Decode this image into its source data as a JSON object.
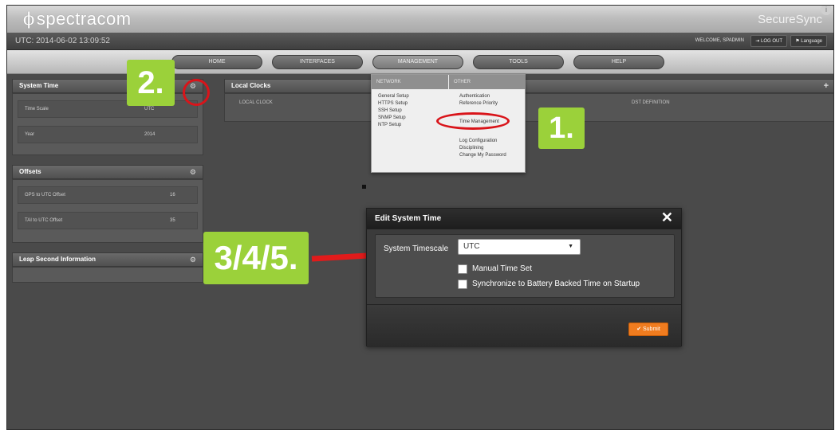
{
  "header": {
    "logo_text": "spectracom",
    "logo_symbol": "ϕ",
    "brand": "SecureSync",
    "brand_icon": "i"
  },
  "status_bar": {
    "utc": "UTC: 2014-06-02 13:09:52",
    "welcome": "WELCOME, SPADMIN",
    "logout": "⇥ LOG OUT",
    "language": "⚑ Language"
  },
  "nav": {
    "items": [
      "HOME",
      "INTERFACES",
      "MANAGEMENT",
      "TOOLS",
      "HELP"
    ]
  },
  "management_menu": {
    "network_header": "NETWORK",
    "other_header": "OTHER",
    "network_items": [
      "General Setup",
      "HTTPS Setup",
      "SSH Setup",
      "SNMP Setup",
      "NTP Setup"
    ],
    "other_items": [
      "Authentication",
      "Reference Priority",
      "Time Management",
      "Log Configuration",
      "Disciplining",
      "Change My Password"
    ]
  },
  "system_time": {
    "title": "System Time",
    "rows": [
      {
        "label": "Time Scale",
        "value": "UTC"
      },
      {
        "label": "Year",
        "value": "2014"
      }
    ]
  },
  "offsets": {
    "title": "Offsets",
    "rows": [
      {
        "label": "GPS to UTC Offset",
        "value": "16"
      },
      {
        "label": "TAI to UTC Offset",
        "value": "35"
      }
    ]
  },
  "leap_second": {
    "title": "Leap Second Information"
  },
  "local_clocks": {
    "title": "Local Clocks",
    "col1": "LOCAL CLOCK",
    "col2": "DST DEFINITION"
  },
  "annotations": {
    "step1": "1.",
    "step2": "2.",
    "step345": "3/4/5."
  },
  "modal": {
    "title": "Edit System Time",
    "close": "✕",
    "timescale_label": "System Timescale",
    "timescale_value": "UTC",
    "manual_time_set": "Manual Time Set",
    "sync_battery": "Synchronize to Battery Backed Time on Startup",
    "submit": "✔ Submit"
  },
  "colors": {
    "annotation_green": "#9bd13a",
    "annotation_red": "#d9141a",
    "submit_orange": "#f07c1f"
  }
}
